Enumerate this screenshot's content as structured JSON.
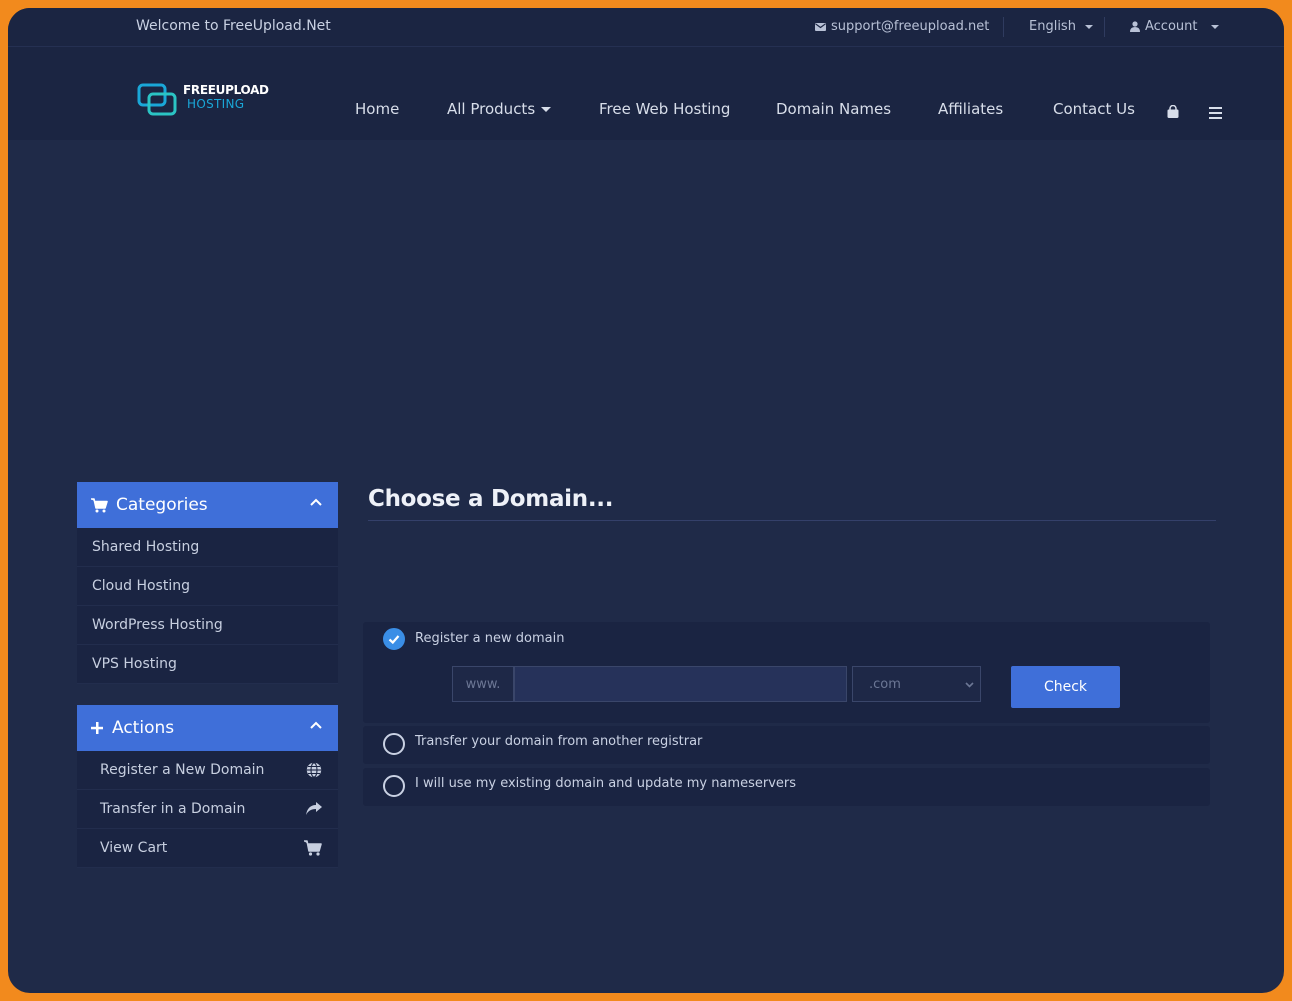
{
  "topbar": {
    "welcome": "Welcome to FreeUpload.Net",
    "email": "support@freeupload.net",
    "language": "English",
    "account": "Account"
  },
  "logo": {
    "line1": "FREEUPLOAD",
    "line2": "HOSTING"
  },
  "nav": {
    "items": [
      "Home",
      "All Products",
      "Free Web Hosting",
      "Domain Names",
      "Affiliates",
      "Contact Us"
    ]
  },
  "categories": {
    "title": "Categories",
    "items": [
      "Shared Hosting",
      "Cloud Hosting",
      "WordPress Hosting",
      "VPS Hosting"
    ]
  },
  "actions": {
    "title": "Actions",
    "items": [
      "Register a New Domain",
      "Transfer in a Domain",
      "View Cart"
    ]
  },
  "main": {
    "title": "Choose a Domain...",
    "options": [
      "Register a new domain",
      "Transfer your domain from another registrar",
      "I will use my existing domain and update my nameservers"
    ],
    "prefix": "www.",
    "domain_value": "",
    "tld": ".com",
    "check_label": "Check"
  },
  "icons": {
    "cart": "cart-icon",
    "plus": "plus-icon",
    "globe": "globe-icon",
    "share": "share-icon",
    "bag": "shopping-bag-icon",
    "menu": "hamburger-icon",
    "mail": "envelope-icon",
    "user": "user-icon"
  },
  "colors": {
    "accent": "#3f6fd9",
    "background": "#1f2a48",
    "frame": "#f28a1d"
  }
}
